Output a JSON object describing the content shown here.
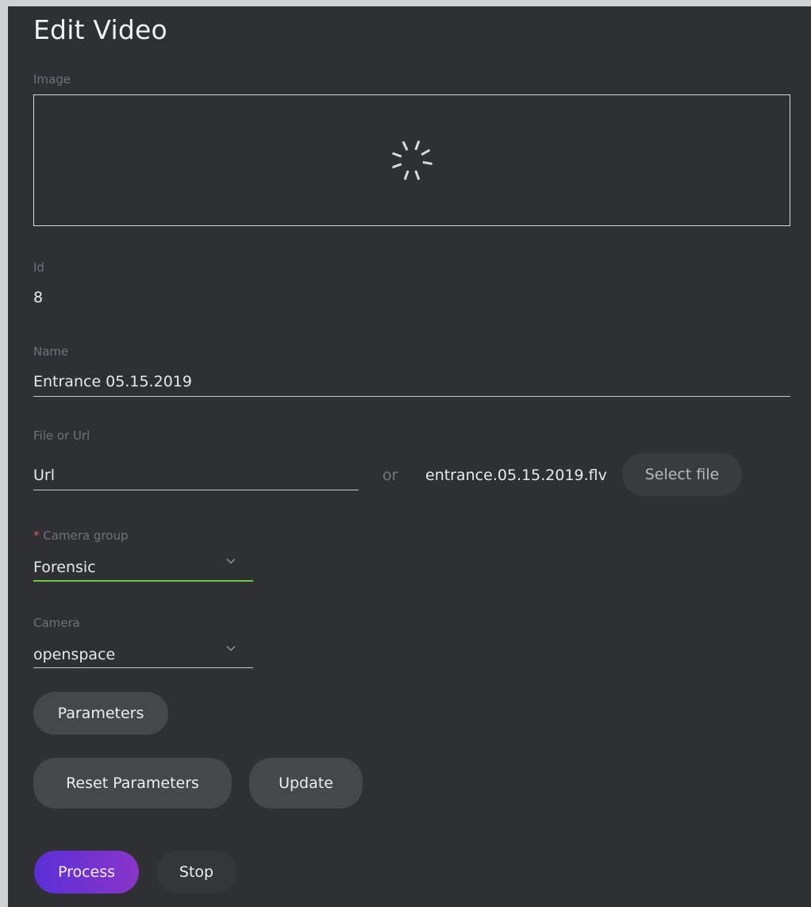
{
  "page": {
    "title": "Edit Video"
  },
  "image": {
    "label": "Image"
  },
  "id": {
    "label": "Id",
    "value": "8"
  },
  "name": {
    "label": "Name",
    "value": "Entrance 05.15.2019"
  },
  "file": {
    "label": "File or Url",
    "url_value": "Url",
    "or_text": "or",
    "filename": "entrance.05.15.2019.flv",
    "select_label": "Select file"
  },
  "camera_group": {
    "required_mark": "*",
    "label": "Camera group",
    "value": "Forensic"
  },
  "camera": {
    "label": "Camera",
    "value": "openspace"
  },
  "buttons": {
    "parameters": "Parameters",
    "reset_parameters": "Reset Parameters",
    "update": "Update",
    "process": "Process",
    "stop": "Stop"
  },
  "colors": {
    "background": "#2f3033",
    "active_underline": "#6ecb3a",
    "primary_start": "#5a2fd6",
    "primary_end": "#8a35c8",
    "required": "#f05454"
  },
  "icons": {
    "loading": "spinner-icon",
    "dropdown": "chevron-down-icon"
  }
}
